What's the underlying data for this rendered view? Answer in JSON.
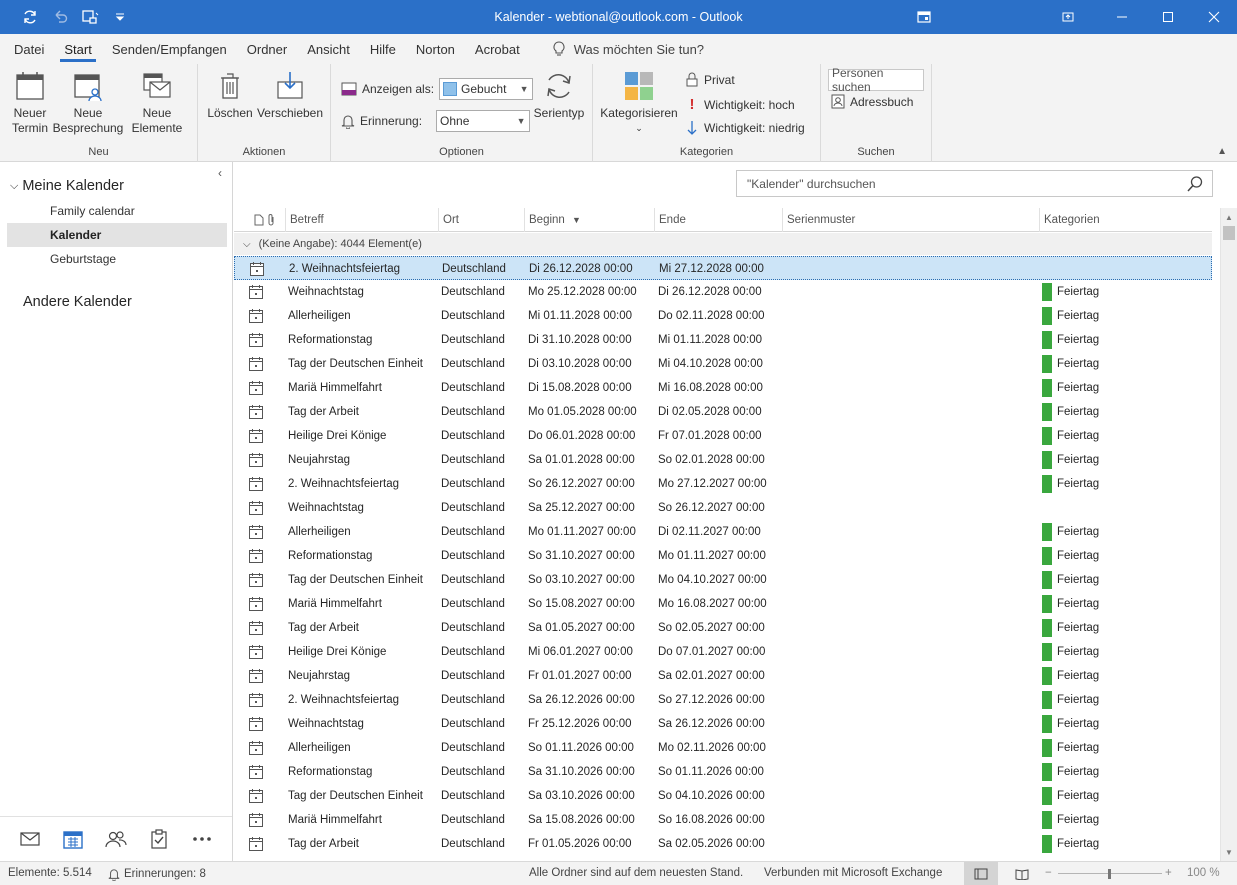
{
  "window": {
    "title": "Kalender - webtional@outlook.com  -  Outlook",
    "accent": "#2b70c8"
  },
  "menu": {
    "tabs": [
      "Datei",
      "Start",
      "Senden/Empfangen",
      "Ordner",
      "Ansicht",
      "Hilfe",
      "Norton",
      "Acrobat"
    ],
    "tell_me": "Was möchten Sie tun?"
  },
  "ribbon": {
    "neu": {
      "label": "Neu",
      "neuer_termin": "Neuer\nTermin",
      "neue_besprechung": "Neue\nBesprechung",
      "neue_elemente": "Neue\nElemente"
    },
    "aktionen": {
      "label": "Aktionen",
      "loeschen": "Löschen",
      "verschieben": "Verschieben"
    },
    "optionen": {
      "label": "Optionen",
      "anzeigen_als": "Anzeigen als:",
      "anzeigen_value": "Gebucht",
      "erinnerung": "Erinnerung:",
      "erinnerung_value": "Ohne",
      "serientyp": "Serientyp"
    },
    "kategorien": {
      "label": "Kategorien",
      "kategorisieren": "Kategorisieren",
      "privat": "Privat",
      "wichtigkeit_hoch": "Wichtigkeit: hoch",
      "wichtigkeit_niedrig": "Wichtigkeit: niedrig"
    },
    "suchen": {
      "label": "Suchen",
      "personen_suchen": "Personen suchen",
      "adressbuch": "Adressbuch"
    }
  },
  "nav": {
    "meine_kalender": "Meine Kalender",
    "items": [
      "Family calendar",
      "Kalender",
      "Geburtstage"
    ],
    "selected": "Kalender",
    "andere_kalender": "Andere Kalender"
  },
  "search": {
    "placeholder": "\"Kalender\" durchsuchen"
  },
  "columns": {
    "betreff": "Betreff",
    "ort": "Ort",
    "beginn": "Beginn",
    "ende": "Ende",
    "serienmuster": "Serienmuster",
    "kategorien": "Kategorien"
  },
  "group_header": "(Keine Angabe): 4044 Element(e)",
  "rows": [
    {
      "subject": "2. Weihnachtsfeiertag",
      "location": "Deutschland",
      "start": "Di 26.12.2028 00:00",
      "end": "Mi 27.12.2028 00:00",
      "category": "",
      "selected": true
    },
    {
      "subject": "Weihnachtstag",
      "location": "Deutschland",
      "start": "Mo 25.12.2028 00:00",
      "end": "Di 26.12.2028 00:00",
      "category": "Feiertag"
    },
    {
      "subject": "Allerheiligen",
      "location": "Deutschland",
      "start": "Mi 01.11.2028 00:00",
      "end": "Do 02.11.2028 00:00",
      "category": "Feiertag"
    },
    {
      "subject": "Reformationstag",
      "location": "Deutschland",
      "start": "Di 31.10.2028 00:00",
      "end": "Mi 01.11.2028 00:00",
      "category": "Feiertag"
    },
    {
      "subject": "Tag der Deutschen Einheit",
      "location": "Deutschland",
      "start": "Di 03.10.2028 00:00",
      "end": "Mi 04.10.2028 00:00",
      "category": "Feiertag"
    },
    {
      "subject": "Mariä Himmelfahrt",
      "location": "Deutschland",
      "start": "Di 15.08.2028 00:00",
      "end": "Mi 16.08.2028 00:00",
      "category": "Feiertag"
    },
    {
      "subject": "Tag der Arbeit",
      "location": "Deutschland",
      "start": "Mo 01.05.2028 00:00",
      "end": "Di 02.05.2028 00:00",
      "category": "Feiertag"
    },
    {
      "subject": "Heilige Drei Könige",
      "location": "Deutschland",
      "start": "Do 06.01.2028 00:00",
      "end": "Fr 07.01.2028 00:00",
      "category": "Feiertag"
    },
    {
      "subject": "Neujahrstag",
      "location": "Deutschland",
      "start": "Sa 01.01.2028 00:00",
      "end": "So 02.01.2028 00:00",
      "category": "Feiertag"
    },
    {
      "subject": "2. Weihnachtsfeiertag",
      "location": "Deutschland",
      "start": "So 26.12.2027 00:00",
      "end": "Mo 27.12.2027 00:00",
      "category": "Feiertag"
    },
    {
      "subject": "Weihnachtstag",
      "location": "Deutschland",
      "start": "Sa 25.12.2027 00:00",
      "end": "So 26.12.2027 00:00",
      "category": ""
    },
    {
      "subject": "Allerheiligen",
      "location": "Deutschland",
      "start": "Mo 01.11.2027 00:00",
      "end": "Di 02.11.2027 00:00",
      "category": "Feiertag"
    },
    {
      "subject": "Reformationstag",
      "location": "Deutschland",
      "start": "So 31.10.2027 00:00",
      "end": "Mo 01.11.2027 00:00",
      "category": "Feiertag"
    },
    {
      "subject": "Tag der Deutschen Einheit",
      "location": "Deutschland",
      "start": "So 03.10.2027 00:00",
      "end": "Mo 04.10.2027 00:00",
      "category": "Feiertag"
    },
    {
      "subject": "Mariä Himmelfahrt",
      "location": "Deutschland",
      "start": "So 15.08.2027 00:00",
      "end": "Mo 16.08.2027 00:00",
      "category": "Feiertag"
    },
    {
      "subject": "Tag der Arbeit",
      "location": "Deutschland",
      "start": "Sa 01.05.2027 00:00",
      "end": "So 02.05.2027 00:00",
      "category": "Feiertag"
    },
    {
      "subject": "Heilige Drei Könige",
      "location": "Deutschland",
      "start": "Mi 06.01.2027 00:00",
      "end": "Do 07.01.2027 00:00",
      "category": "Feiertag"
    },
    {
      "subject": "Neujahrstag",
      "location": "Deutschland",
      "start": "Fr 01.01.2027 00:00",
      "end": "Sa 02.01.2027 00:00",
      "category": "Feiertag"
    },
    {
      "subject": "2. Weihnachtsfeiertag",
      "location": "Deutschland",
      "start": "Sa 26.12.2026 00:00",
      "end": "So 27.12.2026 00:00",
      "category": "Feiertag"
    },
    {
      "subject": "Weihnachtstag",
      "location": "Deutschland",
      "start": "Fr 25.12.2026 00:00",
      "end": "Sa 26.12.2026 00:00",
      "category": "Feiertag"
    },
    {
      "subject": "Allerheiligen",
      "location": "Deutschland",
      "start": "So 01.11.2026 00:00",
      "end": "Mo 02.11.2026 00:00",
      "category": "Feiertag"
    },
    {
      "subject": "Reformationstag",
      "location": "Deutschland",
      "start": "Sa 31.10.2026 00:00",
      "end": "So 01.11.2026 00:00",
      "category": "Feiertag"
    },
    {
      "subject": "Tag der Deutschen Einheit",
      "location": "Deutschland",
      "start": "Sa 03.10.2026 00:00",
      "end": "So 04.10.2026 00:00",
      "category": "Feiertag"
    },
    {
      "subject": "Mariä Himmelfahrt",
      "location": "Deutschland",
      "start": "Sa 15.08.2026 00:00",
      "end": "So 16.08.2026 00:00",
      "category": "Feiertag"
    },
    {
      "subject": "Tag der Arbeit",
      "location": "Deutschland",
      "start": "Fr 01.05.2026 00:00",
      "end": "Sa 02.05.2026 00:00",
      "category": "Feiertag"
    }
  ],
  "category_color": "#3aa73e",
  "status": {
    "elemente": "Elemente: 5.514",
    "erinnerungen": "Erinnerungen: 8",
    "sync": "Alle Ordner sind auf dem neuesten Stand.",
    "connected": "Verbunden mit Microsoft Exchange",
    "zoom": "100 %"
  }
}
